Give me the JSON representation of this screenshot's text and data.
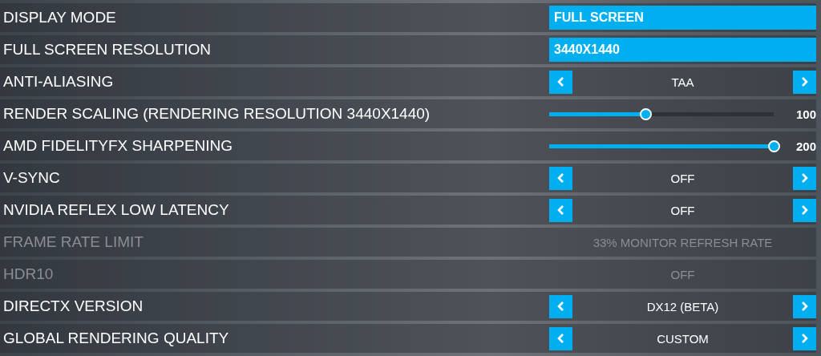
{
  "settings": [
    {
      "label": "DISPLAY MODE",
      "kind": "dropdown",
      "value": "FULL SCREEN",
      "disabled": false
    },
    {
      "label": "FULL SCREEN RESOLUTION",
      "kind": "dropdown",
      "value": "3440X1440",
      "disabled": false
    },
    {
      "label": "ANTI-ALIASING",
      "kind": "selector",
      "value": "TAA",
      "disabled": false
    },
    {
      "label": "RENDER SCALING (RENDERING RESOLUTION 3440X1440)",
      "kind": "slider",
      "level": 0.43,
      "value": "100",
      "disabled": false
    },
    {
      "label": "AMD FIDELITYFX SHARPENING",
      "kind": "slider",
      "level": 1.0,
      "value": "200",
      "disabled": false
    },
    {
      "label": "V-SYNC",
      "kind": "selector",
      "value": "OFF",
      "disabled": false
    },
    {
      "label": "NVIDIA REFLEX LOW LATENCY",
      "kind": "selector",
      "value": "OFF",
      "disabled": false
    },
    {
      "label": "FRAME RATE LIMIT",
      "kind": "selector",
      "value": "33% MONITOR REFRESH RATE",
      "disabled": true
    },
    {
      "label": "HDR10",
      "kind": "selector",
      "value": "OFF",
      "disabled": true
    },
    {
      "label": "DIRECTX VERSION",
      "kind": "selector",
      "value": "DX12 (BETA)",
      "disabled": false
    },
    {
      "label": "GLOBAL RENDERING QUALITY",
      "kind": "selector",
      "value": "CUSTOM",
      "disabled": false
    }
  ]
}
